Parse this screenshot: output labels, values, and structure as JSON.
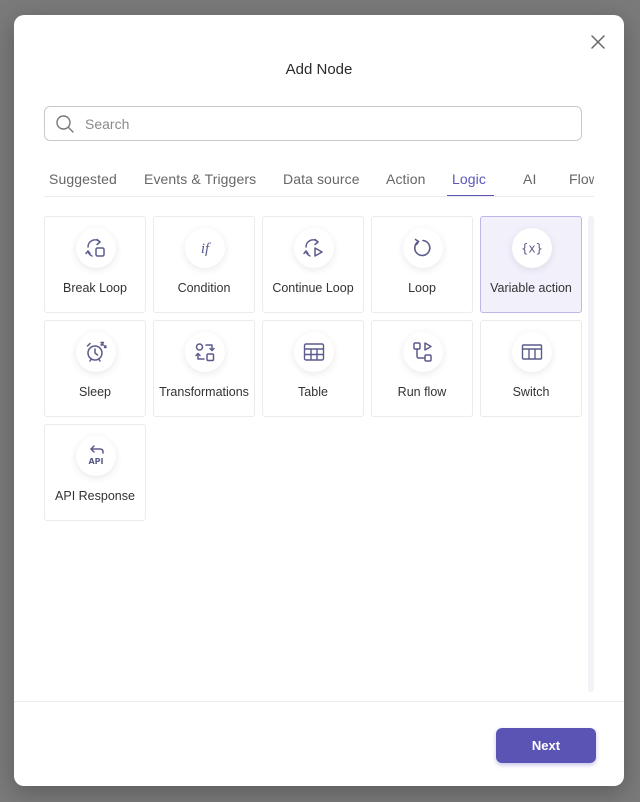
{
  "modal": {
    "title": "Add Node",
    "close_icon": "close-icon"
  },
  "search": {
    "placeholder": "Search",
    "value": "",
    "icon": "search-icon"
  },
  "tabs": [
    {
      "label": "Suggested",
      "active": false
    },
    {
      "label": "Events & Triggers",
      "active": false
    },
    {
      "label": "Data source",
      "active": false
    },
    {
      "label": "Action",
      "active": false
    },
    {
      "label": "Logic",
      "active": true
    },
    {
      "label": "AI",
      "active": false
    },
    {
      "label": "Flow",
      "active": false
    }
  ],
  "nodes": [
    {
      "label": "Break Loop",
      "icon": "break-loop-icon",
      "selected": false
    },
    {
      "label": "Condition",
      "icon": "if-icon",
      "selected": false
    },
    {
      "label": "Continue Loop",
      "icon": "continue-loop-icon",
      "selected": false
    },
    {
      "label": "Loop",
      "icon": "loop-icon",
      "selected": false
    },
    {
      "label": "Variable action",
      "icon": "variable-icon",
      "selected": true
    },
    {
      "label": "Sleep",
      "icon": "alarm-clock-icon",
      "selected": false
    },
    {
      "label": "Transformations",
      "icon": "transform-icon",
      "selected": false
    },
    {
      "label": "Table",
      "icon": "table-icon",
      "selected": false
    },
    {
      "label": "Run flow",
      "icon": "run-flow-icon",
      "selected": false
    },
    {
      "label": "Switch",
      "icon": "switch-icon",
      "selected": false
    },
    {
      "label": "API Response",
      "icon": "api-icon",
      "selected": false
    }
  ],
  "footer": {
    "next_label": "Next"
  },
  "colors": {
    "accent": "#5a54b5",
    "icon": "#5b5b8c",
    "selected_bg": "#f1f0fb",
    "overlay": "#7a7a7a"
  }
}
